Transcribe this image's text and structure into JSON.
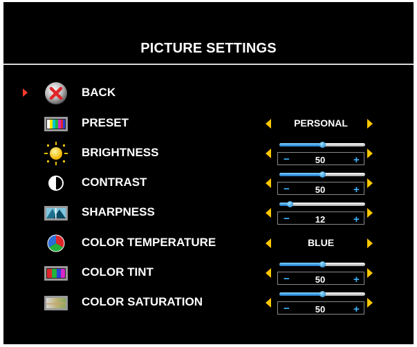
{
  "title": "PICTURE SETTINGS",
  "colors": {
    "background": "#000000",
    "arrow": "#ffc800",
    "cursor": "#ff3b2f",
    "slider_accent": "#3fb5ff"
  },
  "slider_symbols": {
    "minus": "−",
    "plus": "+"
  },
  "items": [
    {
      "label": "BACK",
      "icon": "close-x-icon",
      "selected": true
    },
    {
      "label": "PRESET",
      "icon": "color-bars-tv-icon",
      "value": "PERSONAL"
    },
    {
      "label": "BRIGHTNESS",
      "icon": "sun-icon",
      "level": 50,
      "level_text": "50"
    },
    {
      "label": "CONTRAST",
      "icon": "half-circle-icon",
      "level": 50,
      "level_text": "50"
    },
    {
      "label": "SHARPNESS",
      "icon": "sharpness-tv-icon",
      "level": 12,
      "level_text": "12"
    },
    {
      "label": "COLOR TEMPERATURE",
      "icon": "color-pie-icon",
      "value": "BLUE"
    },
    {
      "label": "COLOR TINT",
      "icon": "color-tint-tv-icon",
      "level": 50,
      "level_text": "50"
    },
    {
      "label": "COLOR SATURATION",
      "icon": "color-saturation-tv-icon",
      "level": 50,
      "level_text": "50"
    }
  ]
}
